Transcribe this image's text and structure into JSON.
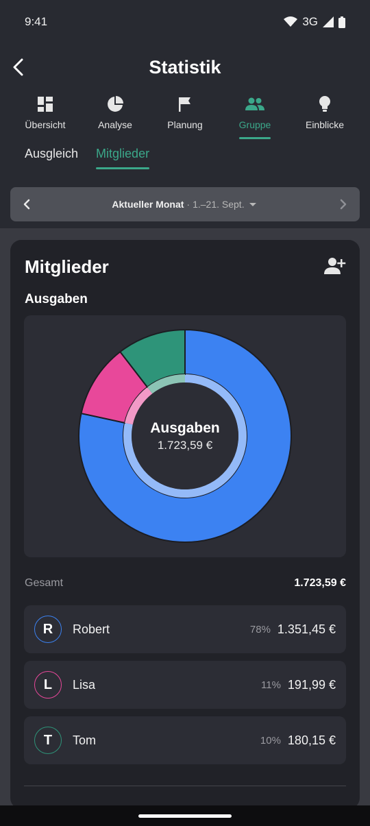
{
  "status": {
    "time": "9:41",
    "network": "3G"
  },
  "header": {
    "title": "Statistik"
  },
  "tabs": [
    {
      "label": "Übersicht",
      "icon": "dashboard-icon"
    },
    {
      "label": "Analyse",
      "icon": "pie-icon"
    },
    {
      "label": "Planung",
      "icon": "flag-icon"
    },
    {
      "label": "Gruppe",
      "icon": "group-icon",
      "active": true
    },
    {
      "label": "Einblicke",
      "icon": "lightbulb-icon"
    }
  ],
  "subtabs": [
    {
      "label": "Ausgleich"
    },
    {
      "label": "Mitglieder",
      "active": true
    }
  ],
  "period": {
    "label": "Aktueller Monat",
    "separator": "·",
    "range": "1.–21. Sept."
  },
  "card": {
    "title": "Mitglieder",
    "section": "Ausgaben",
    "chart_center_title": "Ausgaben",
    "chart_center_value": "1.723,59 €"
  },
  "chart_data": {
    "type": "pie",
    "variant": "donut",
    "title": "Ausgaben",
    "total": 1723.59,
    "series": [
      {
        "name": "Robert",
        "value": 1351.45,
        "percent": 78,
        "color": "#3c82f2"
      },
      {
        "name": "Lisa",
        "value": 191.99,
        "percent": 11,
        "color": "#e8489a"
      },
      {
        "name": "Tom",
        "value": 180.15,
        "percent": 10,
        "color": "#2e9479"
      }
    ]
  },
  "totals": {
    "label": "Gesamt",
    "value": "1.723,59 €"
  },
  "members": [
    {
      "initial": "R",
      "name": "Robert",
      "percent": "78%",
      "amount": "1.351,45 €",
      "color": "#3c82f2"
    },
    {
      "initial": "L",
      "name": "Lisa",
      "percent": "11%",
      "amount": "191,99 €",
      "color": "#e8489a"
    },
    {
      "initial": "T",
      "name": "Tom",
      "percent": "10%",
      "amount": "180,15 €",
      "color": "#2e9479"
    }
  ],
  "colors": {
    "accent": "#3ba88a",
    "background": "#282a31",
    "card": "#212228"
  }
}
